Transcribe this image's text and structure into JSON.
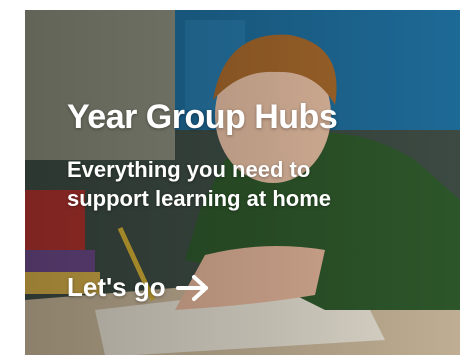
{
  "hub_card": {
    "title": "Year Group Hubs",
    "subtitle": "Everything you need to support learning at home",
    "cta_label": "Let's go",
    "cta_icon": "arrow-right-icon",
    "background_image": "boy-writing-at-desk-photo"
  },
  "colors": {
    "text": "#ffffff",
    "wall": "#1f6f9e",
    "shirt": "#2f5a2c",
    "desk": "#c9b79a"
  }
}
